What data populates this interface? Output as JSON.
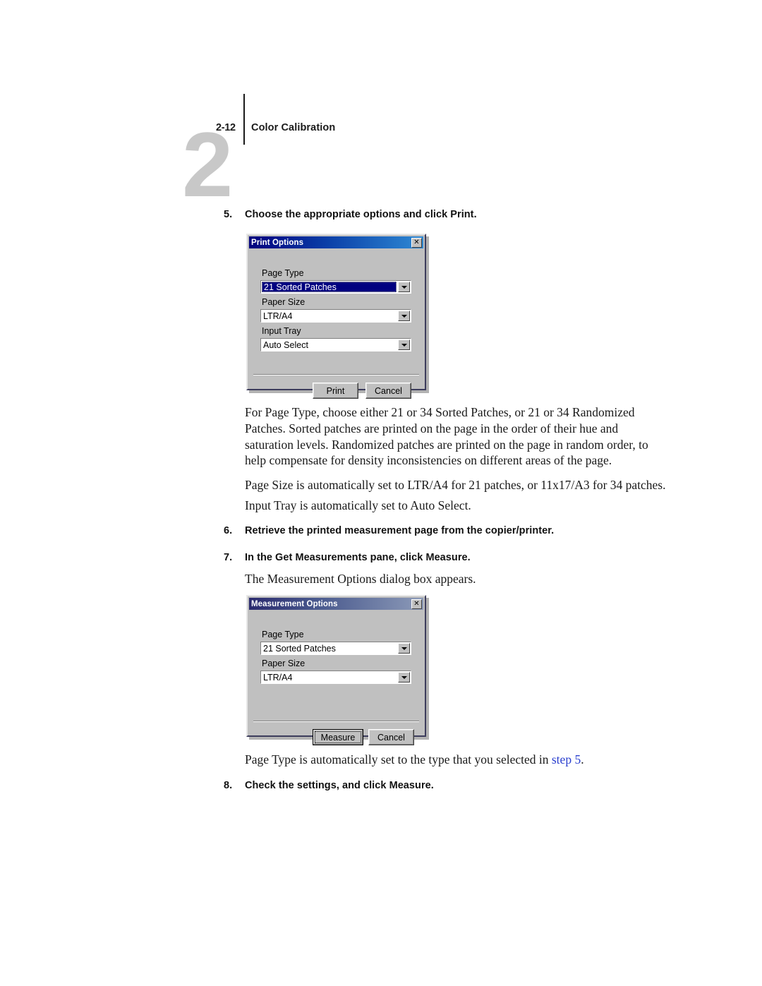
{
  "header": {
    "chapter_mark": "2",
    "page_number": "2-12",
    "title": "Color Calibration"
  },
  "steps": {
    "step5": {
      "num": "5.",
      "text": "Choose the appropriate options and click Print."
    },
    "step6": {
      "num": "6.",
      "text": "Retrieve the printed measurement page from the copier/printer."
    },
    "step7": {
      "num": "7.",
      "text": "In the Get Measurements pane, click Measure."
    },
    "step8": {
      "num": "8.",
      "text": "Check the settings, and click Measure."
    }
  },
  "paragraphs": {
    "page_type_desc": "For Page Type, choose either 21 or 34 Sorted Patches, or 21 or 34 Randomized Patches. Sorted patches are printed on the page in the order of their hue and saturation levels. Randomized patches are printed on the page in random order, to help compensate for density inconsistencies on different areas of the page.",
    "page_size_note": "Page Size is automatically set to LTR/A4 for 21 patches, or 11x17/A3 for 34 patches.",
    "input_tray_note": "Input Tray is automatically set to Auto Select.",
    "dialog_appears": "The Measurement Options dialog box appears.",
    "page_type_auto_prefix": "Page Type is automatically set to the type that you selected in ",
    "page_type_auto_link": "step 5",
    "page_type_auto_suffix": "."
  },
  "print_dialog": {
    "title": "Print Options",
    "close_glyph": "✕",
    "fields": {
      "page_type_label": "Page Type",
      "page_type_value": "21 Sorted Patches",
      "paper_size_label": "Paper Size",
      "paper_size_value": "LTR/A4",
      "input_tray_label": "Input Tray",
      "input_tray_value": "Auto Select"
    },
    "buttons": {
      "ok_label": "Print",
      "cancel_label": "Cancel"
    }
  },
  "measurement_dialog": {
    "title": "Measurement Options",
    "close_glyph": "✕",
    "fields": {
      "page_type_label": "Page Type",
      "page_type_value": "21 Sorted Patches",
      "paper_size_label": "Paper Size",
      "paper_size_value": "LTR/A4"
    },
    "buttons": {
      "ok_label": "Measure",
      "cancel_label": "Cancel"
    }
  },
  "colors": {
    "titlebar_active_start": "#00007e",
    "titlebar_active_end": "#2f8ad4",
    "titlebar_inactive_start": "#2a2a6e",
    "titlebar_inactive_end": "#8c9ab8",
    "dialog_face": "#c0c0c0",
    "selection": "#000080",
    "link": "#2a3fcf",
    "watermark": "#c8c8c8"
  }
}
